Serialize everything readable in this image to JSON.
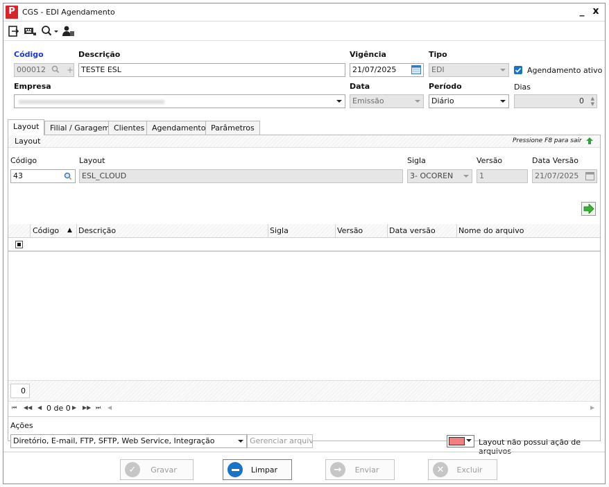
{
  "window": {
    "title": "CGS - EDI Agendamento",
    "minimize": "_",
    "close": "x"
  },
  "toolbar": {
    "icons": [
      "exit-icon",
      "keyboard-icon",
      "search-icon",
      "user-icon"
    ]
  },
  "form": {
    "codigo_label": "Código",
    "codigo_value": "000012",
    "descricao_label": "Descrição",
    "descricao_value": "TESTE ESL",
    "vigencia_label": "Vigência",
    "vigencia_value": "21/07/2025",
    "tipo_label": "Tipo",
    "tipo_value": "EDI",
    "agendamento_ativo_label": "Agendamento ativo",
    "agendamento_ativo_checked": true,
    "empresa_label": "Empresa",
    "data_label": "Data",
    "data_value": "Emissão",
    "periodo_label": "Período",
    "periodo_value": "Diário",
    "dias_label": "Dias",
    "dias_value": "0"
  },
  "tabs": [
    "Layout",
    "Filial / Garagem",
    "Clientes",
    "Agendamento",
    "Parâmetros"
  ],
  "layout_tab": {
    "section_title": "Layout",
    "hint": "Pressione F8 para sair",
    "codigo_label": "Código",
    "codigo_value": "43",
    "layout_label": "Layout",
    "layout_value": "ESL_CLOUD",
    "sigla_label": "Sigla",
    "sigla_value": "3- OCOREN",
    "versao_label": "Versão",
    "versao_value": "1",
    "data_versao_label": "Data Versão",
    "data_versao_value": "21/07/2025",
    "grid": {
      "columns": [
        "Código",
        "Descrição",
        "Sigla",
        "Versão",
        "Data versão",
        "Nome do arquivo"
      ],
      "count": "0",
      "pager": "0 de 0"
    },
    "acoes_label": "Ações",
    "acoes_value": "Diretório, E-mail, FTP, SFTP, Web Service, Integração",
    "gerenciar_label": "Gerenciar arquivos",
    "legend_text": "Layout não possui ação de arquivos",
    "legend_color": "#f08080"
  },
  "buttons": {
    "gravar": "Gravar",
    "limpar": "Limpar",
    "enviar": "Enviar",
    "excluir": "Excluir"
  },
  "colors": {
    "accent": "#1a73c7",
    "brand_red": "#d6262b",
    "codigo_label": "#1a35d6",
    "green": "#2fa33a"
  }
}
